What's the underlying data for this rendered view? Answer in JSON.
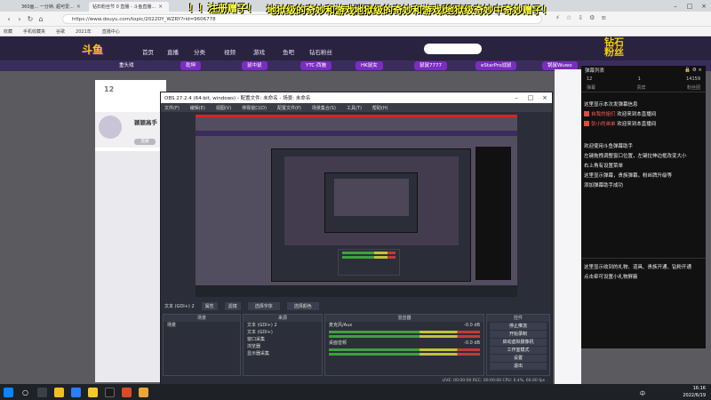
{
  "browser": {
    "tabs": [
      {
        "label": "360画... 一分钟, 超可爱...",
        "active": false
      },
      {
        "label": "钻石粉丝节 0 直播 - 斗鱼直播...",
        "active": true
      }
    ],
    "url": "https://www.douyu.com/topic/2022DY_WZRY?rid=9606778",
    "bookmarks": [
      "收藏",
      "手机收藏夹",
      "谷歌",
      "2021年",
      "直播中心"
    ]
  },
  "danmaku": [
    "！！注册赠子！",
    "地狱级的奇妙和游戏赠子！",
    "地狱级的奇妙和游戏赠子！",
    "地狱级奇妙中奇妙赠子！"
  ],
  "site": {
    "logo": "斗鱼",
    "nav": [
      "首页",
      "直播",
      "分类",
      "视频",
      "游戏",
      "鱼吧",
      "钻石粉丝"
    ],
    "event_logo": "钻石\n粉丝",
    "subnav": [
      "重头戏",
      "乾坤",
      "鼠中鼠",
      "YTC·西施",
      "HK鼠女",
      "鼠鼠7777",
      "eStarPro战鼠",
      "锅鼠Wuwo"
    ],
    "fans_count": "12",
    "streamer_name": "颖颖高手",
    "streamer_tag": "直播"
  },
  "obs": {
    "title": "OBS 27.2.4 (64-bit, windows) - 配置文件: 未命名 - 场景: 未命名",
    "menu": [
      "文件(F)",
      "编辑(E)",
      "视图(V)",
      "停靠窗口(D)",
      "配置文件(P)",
      "场景集合(S)",
      "工具(T)",
      "帮助(H)"
    ],
    "source_bar": [
      "文本 (GDI+) 2",
      "属性",
      "滤镜",
      "选择字体",
      "选择颜色"
    ],
    "panels": {
      "scenes_title": "场景",
      "scene_item": "场景",
      "sources_title": "来源",
      "sources": [
        "文本 (GDI+) 2",
        "文本 (GDI+)",
        "窗口采集",
        "浏览器",
        "显示器采集"
      ],
      "mixer_title": "混音器",
      "mixer": [
        {
          "name": "麦克风/Aux",
          "db": "-0.0 dB"
        },
        {
          "name": "桌面音频",
          "db": "-0.0 dB"
        }
      ],
      "controls_title": "控件",
      "controls": [
        "停止推流",
        "开始录制",
        "启动虚拟摄像机",
        "工作室模式",
        "设置",
        "退出"
      ]
    },
    "status": "LIVE: 00:00:00   REC: 00:00:00   CPU: 0.4%, 60.00 fps"
  },
  "chat": {
    "header": "弹幕列表",
    "stats": [
      {
        "label": "亲密度",
        "value": "12"
      },
      {
        "label": "贡献",
        "value": "1"
      },
      {
        "label": "在线",
        "value": "14159"
      }
    ],
    "tabs": [
      "弹幕",
      "贵宾",
      "粉丝团"
    ],
    "lines": [
      {
        "text": "这里显示本次发弹幕信息",
        "name": ""
      },
      {
        "name": "自我的姐们",
        "text": "欢迎来到本直播间"
      },
      {
        "name": "张小的弟弟",
        "text": "欢迎来到本直播间"
      },
      {
        "text": "欢迎使用斗鱼弹幕助手",
        "name": ""
      },
      {
        "text": "左键拖拽调整窗口位置，左键拉伸边框改变大小",
        "name": ""
      },
      {
        "text": "右上角有设置菜单",
        "name": ""
      },
      {
        "text": "这里显示弹幕，贵族弹幕，粉丝牌升级等",
        "name": ""
      },
      {
        "text": "添加弹幕助手成功",
        "name": ""
      }
    ],
    "gift_lines": [
      "这里显示收到的礼物、道具、贵族开通、钻粉开通",
      "点击牵可设置小礼物屏蔽"
    ]
  },
  "taskbar": {
    "time": "16:16",
    "date": "2022/6/19",
    "lang": "中"
  }
}
